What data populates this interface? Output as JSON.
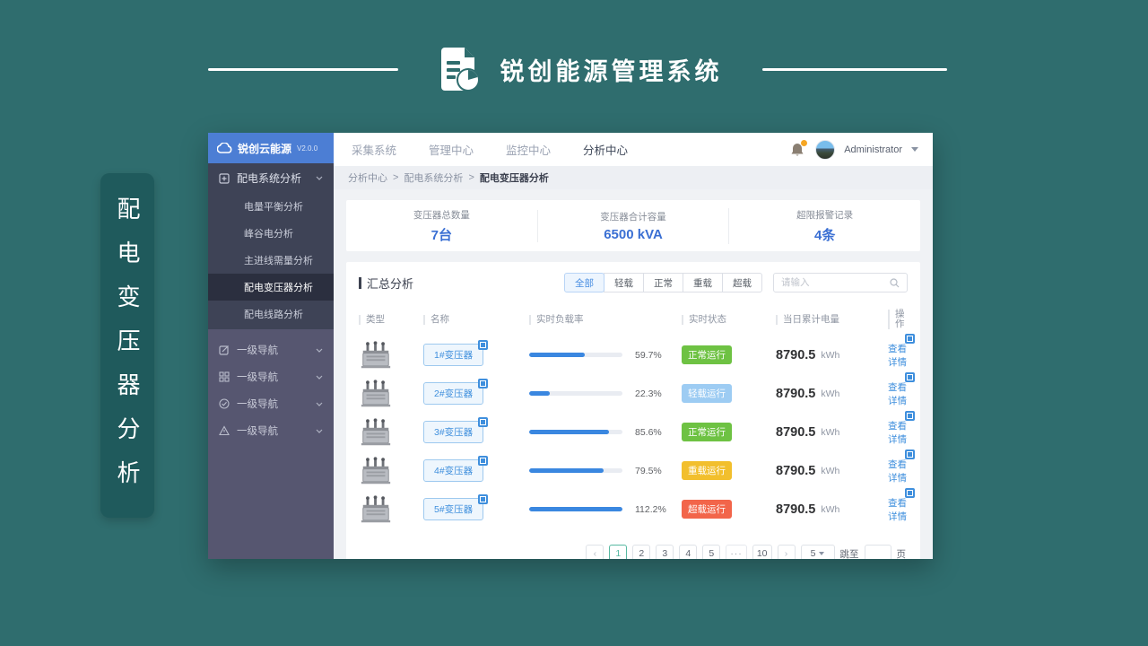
{
  "colors": {
    "teal_background": "#2f6d6e",
    "side_banner": "#1f5a5c",
    "logo_blue": "#4c7ed4",
    "accent_blue": "#3a87e0",
    "stat_value_blue": "#3a6fd3",
    "status_normal_green": "#6ec243",
    "status_light_blue": "#9dccf3",
    "status_heavy_yellow": "#f2bf2d",
    "status_over_red": "#f2654a",
    "pagination_active_teal": "#57b9a2",
    "notification_orange": "#f6a623"
  },
  "banner": {
    "title": "锐创能源管理系统",
    "side_vertical_text": "配电变压器分析"
  },
  "app": {
    "logo": {
      "name": "锐创云能源",
      "version": "V2.0.0"
    },
    "sidebar": {
      "group_label": "配电系统分析",
      "submenu": [
        {
          "label": "电量平衡分析"
        },
        {
          "label": "峰谷电分析"
        },
        {
          "label": "主进线需量分析"
        },
        {
          "label": "配电变压器分析"
        },
        {
          "label": "配电线路分析"
        }
      ],
      "nav_items": [
        {
          "label": "一级导航"
        },
        {
          "label": "一级导航"
        },
        {
          "label": "一级导航"
        },
        {
          "label": "一级导航"
        }
      ]
    },
    "topnav": {
      "items": [
        {
          "label": "采集系统"
        },
        {
          "label": "管理中心"
        },
        {
          "label": "监控中心"
        },
        {
          "label": "分析中心"
        }
      ],
      "user_name": "Administrator"
    },
    "breadcrumb": {
      "separator": ">",
      "items": [
        {
          "label": "分析中心"
        },
        {
          "label": "配电系统分析"
        },
        {
          "label": "配电变压器分析"
        }
      ]
    },
    "stats": [
      {
        "label": "变压器总数量",
        "value": "7台"
      },
      {
        "label": "变压器合计容量",
        "value": "6500 kVA"
      },
      {
        "label": "超限报警记录",
        "value": "4条"
      }
    ],
    "summary": {
      "title": "汇总分析",
      "filters": [
        {
          "label": "全部"
        },
        {
          "label": "轻载"
        },
        {
          "label": "正常"
        },
        {
          "label": "重载"
        },
        {
          "label": "超载"
        }
      ],
      "active_filter": "全部",
      "search_placeholder": "请输入",
      "table": {
        "columns": [
          {
            "label": "类型"
          },
          {
            "label": "名称"
          },
          {
            "label": "实时负载率"
          },
          {
            "label": "实时状态"
          },
          {
            "label": "当日累计电量"
          },
          {
            "label": "操作"
          }
        ],
        "rows": [
          {
            "name": "1#变压器",
            "load_percent": 59.7,
            "load_label": "59.7%",
            "status": "正常运行",
            "status_type": "normal",
            "energy": "8790.5",
            "energy_unit": "kWh",
            "action": "查看详情"
          },
          {
            "name": "2#变压器",
            "load_percent": 22.3,
            "load_label": "22.3%",
            "status": "轻载运行",
            "status_type": "light",
            "energy": "8790.5",
            "energy_unit": "kWh",
            "action": "查看详情"
          },
          {
            "name": "3#变压器",
            "load_percent": 85.6,
            "load_label": "85.6%",
            "status": "正常运行",
            "status_type": "normal",
            "energy": "8790.5",
            "energy_unit": "kWh",
            "action": "查看详情"
          },
          {
            "name": "4#变压器",
            "load_percent": 79.5,
            "load_label": "79.5%",
            "status": "重载运行",
            "status_type": "heavy",
            "energy": "8790.5",
            "energy_unit": "kWh",
            "action": "查看详情"
          },
          {
            "name": "5#变压器",
            "load_percent": 112.2,
            "load_label": "112.2%",
            "status": "超载运行",
            "status_type": "over",
            "energy": "8790.5",
            "energy_unit": "kWh",
            "action": "查看详情"
          }
        ]
      },
      "pagination": {
        "prev": "‹",
        "next": "›",
        "pages": [
          {
            "label": "1"
          },
          {
            "label": "2"
          },
          {
            "label": "3"
          },
          {
            "label": "4"
          },
          {
            "label": "5"
          },
          {
            "label": "···"
          },
          {
            "label": "10"
          }
        ],
        "active_page": "1",
        "page_size": "5",
        "jump_label": "跳至",
        "jump_suffix": "页"
      }
    }
  }
}
